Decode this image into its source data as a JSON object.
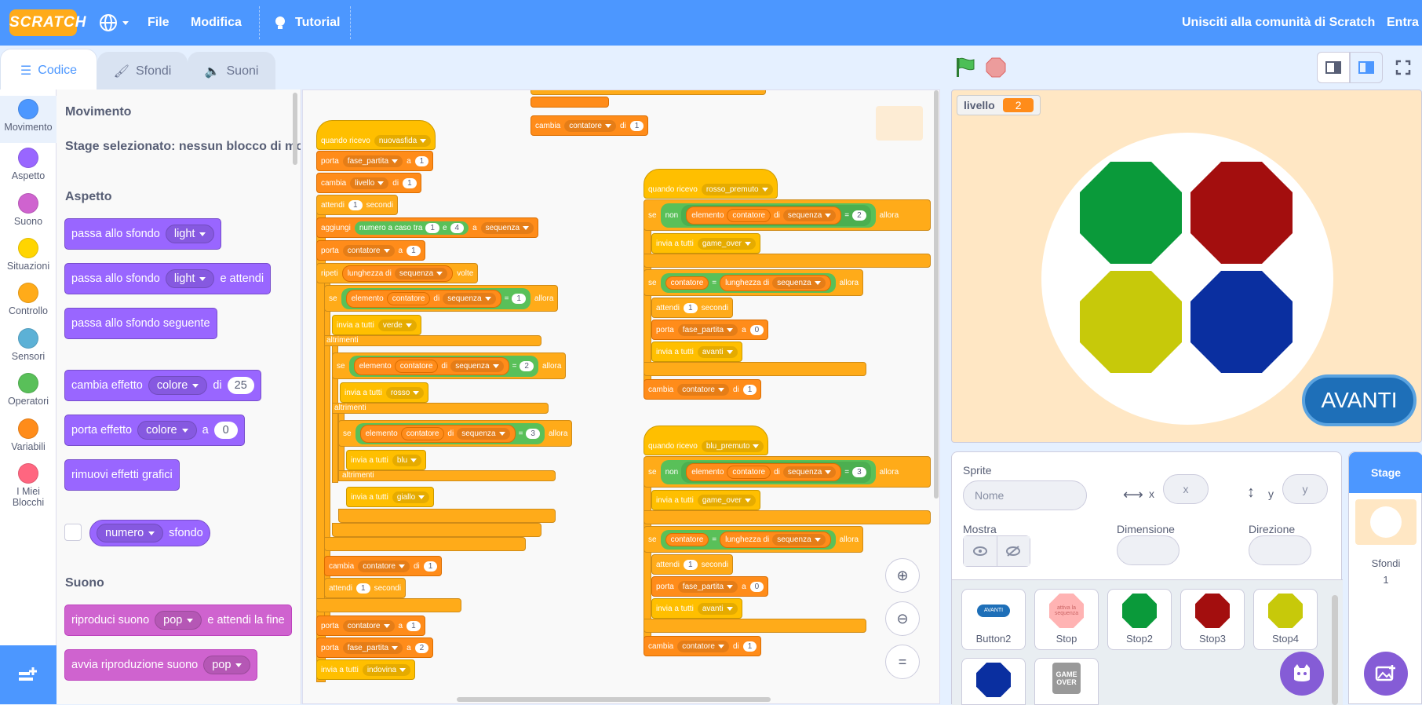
{
  "menu": {
    "logo": "SCRATCH",
    "file": "File",
    "edit": "Modifica",
    "tutorial": "Tutorial",
    "join": "Unisciti alla comunità di Scratch",
    "signin": "Entra"
  },
  "tabs": {
    "code": "Codice",
    "backdrops": "Sfondi",
    "sounds": "Suoni"
  },
  "categories": [
    {
      "label": "Movimento",
      "color": "#4c97ff"
    },
    {
      "label": "Aspetto",
      "color": "#9966ff"
    },
    {
      "label": "Suono",
      "color": "#cf63cf"
    },
    {
      "label": "Situazioni",
      "color": "#ffd500"
    },
    {
      "label": "Controllo",
      "color": "#ffab19"
    },
    {
      "label": "Sensori",
      "color": "#5cb1d6"
    },
    {
      "label": "Operatori",
      "color": "#59c059"
    },
    {
      "label": "Variabili",
      "color": "#ff8c1a"
    },
    {
      "label": "I Miei Blocchi",
      "color": "#ff6680"
    }
  ],
  "palette": {
    "motion_header": "Movimento",
    "motion_note": "Stage selezionato: nessun blocco di mo",
    "looks_header": "Aspetto",
    "switch_backdrop": "passa allo sfondo",
    "backdrop_light": "light",
    "and_wait": "e attendi",
    "next_backdrop": "passa allo sfondo seguente",
    "change_effect": "cambia effetto",
    "effect_color": "colore",
    "by": "di",
    "change_value": "25",
    "set_effect": "porta effetto",
    "to": "a",
    "set_value": "0",
    "clear_effects": "rimuovi effetti grafici",
    "number": "numero",
    "backdrop": "sfondo",
    "sound_header": "Suono",
    "play_until_done": "riproduci suono",
    "sound_pop": "pop",
    "until_done_suffix": "e attendi la fine",
    "start_sound": "avvia riproduzione suono"
  },
  "script1": {
    "when_receive": "quando ricevo",
    "msg_new": "nuovasfida",
    "set": "porta",
    "var_phase": "fase_partita",
    "to": "a",
    "v1": "1",
    "change": "cambia",
    "var_level": "livello",
    "by": "di",
    "wait": "attendi",
    "seconds": "secondi",
    "add": "aggiungi",
    "random": "numero a caso tra",
    "and": "e",
    "r_max": "4",
    "list_seq": "sequenza",
    "var_counter": "contatore",
    "repeat": "ripeti",
    "length_of": "lunghezza di",
    "times": "volte",
    "if": "se",
    "item": "elemento",
    "of": "di",
    "eq": "=",
    "then": "allora",
    "broadcast": "invia a tutti",
    "msg_green": "verde",
    "msg_red": "rosso",
    "msg_blue": "blu",
    "msg_yellow": "giallo",
    "msg_guess": "indovina",
    "else": "altrimenti",
    "v2": "2",
    "v3": "3"
  },
  "script2": {
    "when_receive": "quando ricevo",
    "msg": "rosso_premuto",
    "not": "non",
    "num": "2",
    "game_over": "game_over",
    "forward": "avanti",
    "zero": "0"
  },
  "script3": {
    "msg": "blu_premuto",
    "num": "3"
  },
  "stage": {
    "var_name": "livello",
    "var_value": "2",
    "avanti": "AVANTI"
  },
  "sprite_info": {
    "sprite_label": "Sprite",
    "name_placeholder": "Nome",
    "x_label": "x",
    "x_placeholder": "x",
    "y_label": "y",
    "y_placeholder": "y",
    "show_label": "Mostra",
    "size_label": "Dimensione",
    "direction_label": "Direzione"
  },
  "sprites": [
    {
      "name": "Button2",
      "color": "#4c97ff",
      "shape": "pill"
    },
    {
      "name": "Stop",
      "color": "#ffb3b3",
      "shape": "oct"
    },
    {
      "name": "Stop2",
      "color": "#0a9a3a",
      "shape": "oct"
    },
    {
      "name": "Stop3",
      "color": "#a30e0e",
      "shape": "oct"
    },
    {
      "name": "Stop4",
      "color": "#c7c90a",
      "shape": "oct"
    },
    {
      "name": "",
      "color": "#0a2fa0",
      "shape": "oct"
    },
    {
      "name": "",
      "color": "#999999",
      "shape": "square"
    }
  ],
  "thumb_texts": {
    "button2": "AVANTI",
    "stop": "attiva la sequenza",
    "gameover": "GAME OVER"
  },
  "stage_col": {
    "title": "Stage",
    "backdrops_label": "Sfondi",
    "backdrops_count": "1"
  }
}
